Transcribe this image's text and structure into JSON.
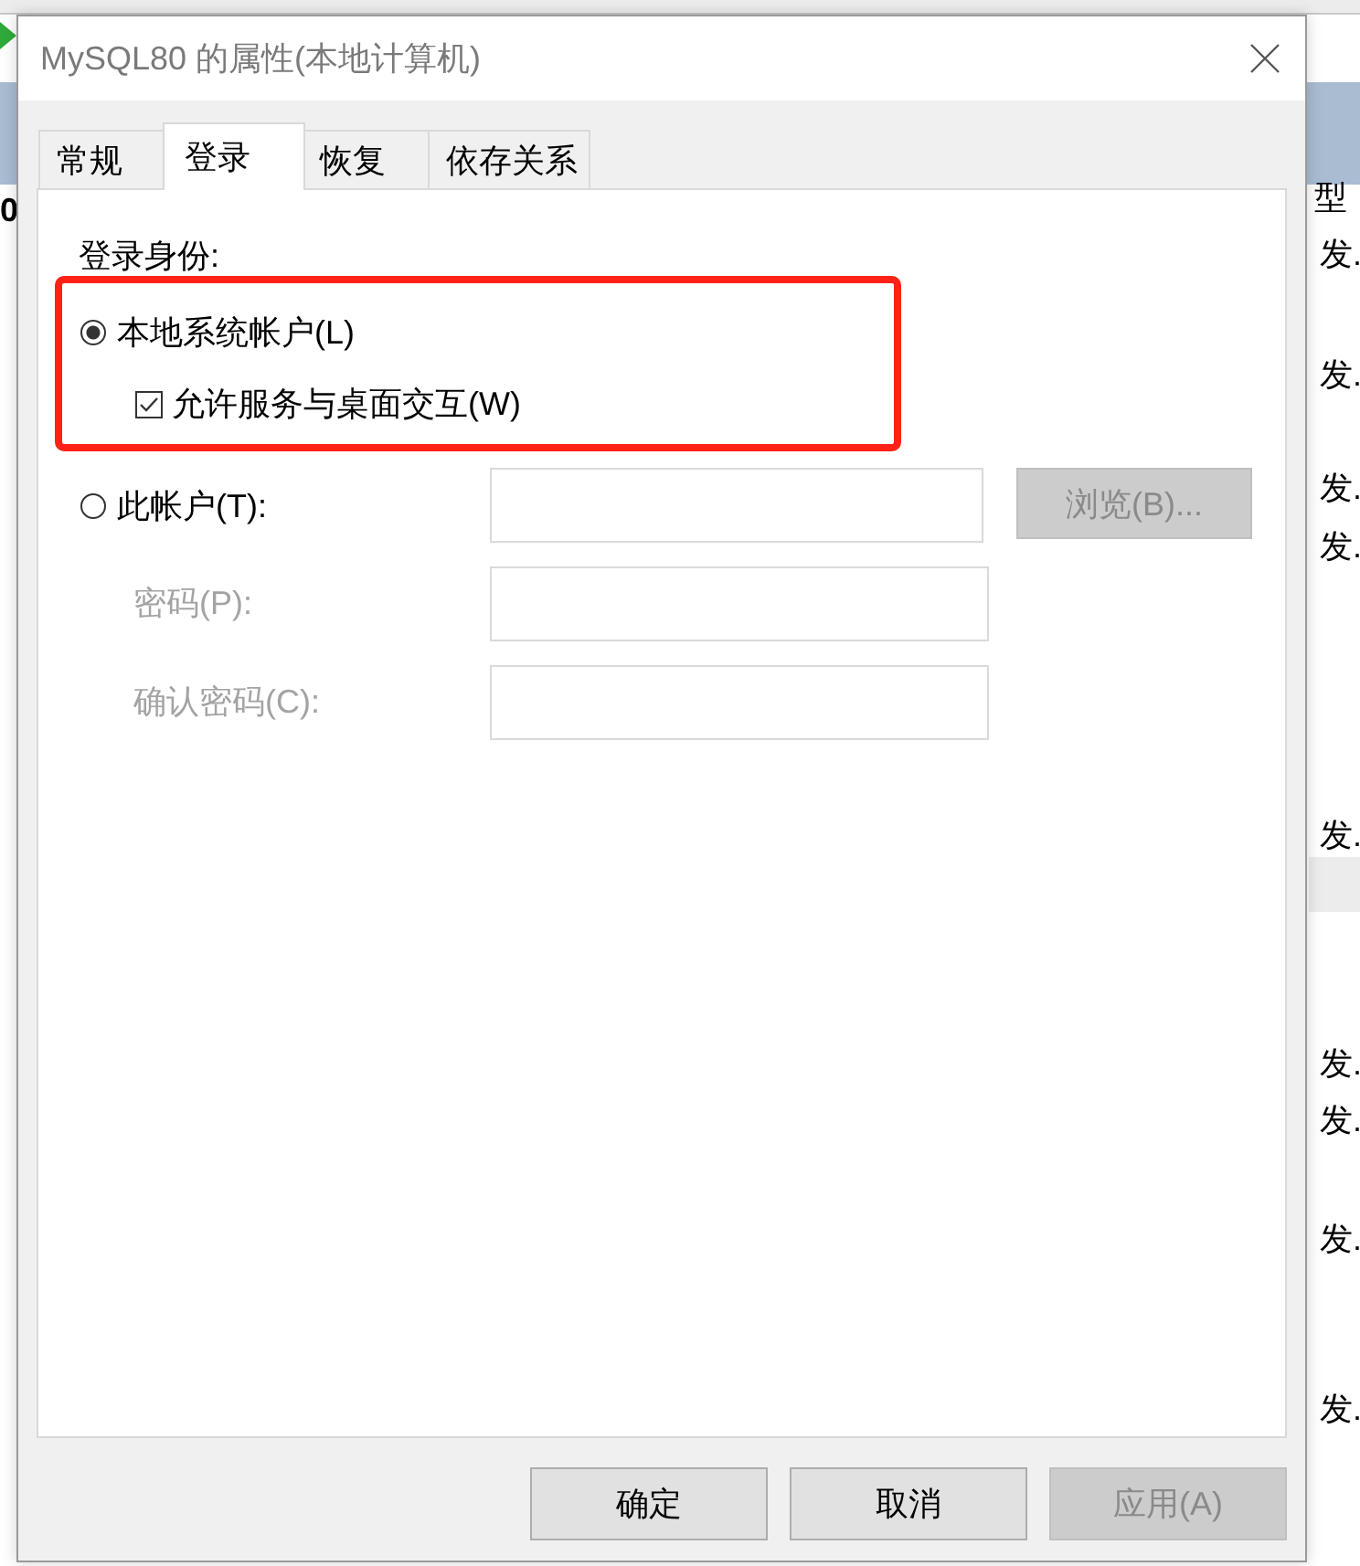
{
  "background_window": {
    "left_cell": "0",
    "column_header": "型",
    "rows": [
      {
        "cell": "发."
      },
      {
        "cell": "发."
      },
      {
        "cell": "发."
      },
      {
        "cell": "发."
      },
      {
        "cell": "发."
      },
      {
        "cell": "发."
      },
      {
        "cell": "发."
      },
      {
        "cell": "发."
      },
      {
        "cell": "发."
      }
    ]
  },
  "dialog": {
    "title": "MySQL80 的属性(本地计算机)",
    "tabs": [
      {
        "label": "常规",
        "selected": false
      },
      {
        "label": "登录",
        "selected": true
      },
      {
        "label": "恢复",
        "selected": false
      },
      {
        "label": "依存关系",
        "selected": false
      }
    ],
    "logon": {
      "heading": "登录身份:",
      "local_system": {
        "label": "本地系统帐户(L)",
        "selected": true,
        "highlighted": true,
        "interact_desktop": {
          "label": "允许服务与桌面交互(W)",
          "checked": true
        }
      },
      "this_account": {
        "label": "此帐户(T):",
        "selected": false,
        "browse_button": {
          "label": "浏览(B)...",
          "disabled": true
        }
      },
      "password": {
        "label": "密码(P):",
        "disabled": true
      },
      "confirm_password": {
        "label": "确认密码(C):",
        "disabled": true
      }
    },
    "buttons": [
      {
        "label": "确定",
        "disabled": false
      },
      {
        "label": "取消",
        "disabled": false
      },
      {
        "label": "应用(A)",
        "disabled": true
      }
    ]
  }
}
